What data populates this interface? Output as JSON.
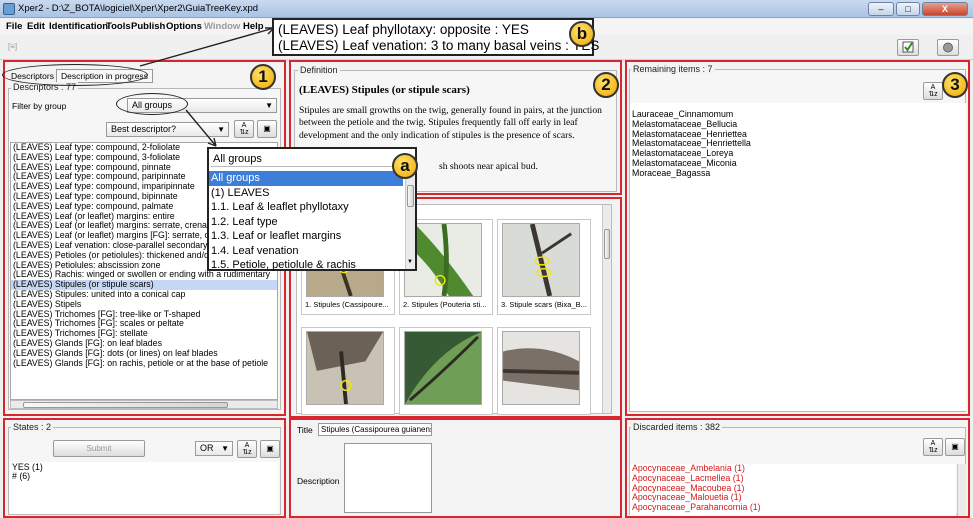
{
  "window": {
    "title": "Xper2 - D:\\Z_BOTA\\logiciel\\Xper\\Xper2\\GuiaTreeKey.xpd",
    "minimize": "–",
    "maximize": "□",
    "close": "X"
  },
  "menu": [
    "File",
    "Edit",
    "Identification",
    "Tools",
    "Publish",
    "Options",
    "Window",
    "Help"
  ],
  "callout_b": {
    "line1": "(LEAVES) Leaf phyllotaxy: opposite : YES",
    "line2": "(LEAVES) Leaf venation: 3 to many basal veins : YES",
    "badge": "b"
  },
  "panel1": {
    "badge": "1",
    "tab_descriptors": "Descriptors",
    "tab_progress": "Description in progress",
    "descriptors_legend": "Descriptors : 77",
    "filter_label": "Filter by group",
    "filter_value": "All groups",
    "best_descriptor": "Best descriptor?",
    "descriptors": [
      "(LEAVES) Leaf type: compound, 2-foliolate",
      "(LEAVES) Leaf type: compound, 3-foliolate",
      "(LEAVES) Leaf type: compound, pinnate",
      "(LEAVES) Leaf type: compound, paripinnate",
      "(LEAVES) Leaf type: compound, imparipinnate",
      "(LEAVES) Leaf type: compound, bipinnate",
      "(LEAVES) Leaf type: compound, palmate",
      "(LEAVES) Leaf (or leaflet) margins: entire",
      "(LEAVES) Leaf (or leaflet) margins: serrate, crenate",
      "(LEAVES) Leaf (or leaflet) margins [FG]: serrate, cre",
      "(LEAVES) Leaf venation: close-parallel secondary",
      "(LEAVES) Petioles (or petiolules): thickened and/or flexed at apex",
      "(LEAVES) Petiolules: abscission zone",
      "(LEAVES) Rachis: winged or swollen or ending with a rudimentary",
      "(LEAVES) Stipules (or stipule scars)",
      "(LEAVES) Stipules: united into a conical cap",
      "(LEAVES) Stipels",
      "(LEAVES) Trichomes [FG]: tree-like or T-shaped",
      "(LEAVES) Trichomes [FG]: scales or peltate",
      "(LEAVES) Trichomes [FG]: stellate",
      "(LEAVES) Glands [FG]: on leaf blades",
      "(LEAVES) Glands [FG]: dots (or lines) on leaf blades",
      "(LEAVES) Glands [FG]: on rachis, petiole or at the base of petiole"
    ],
    "selected_index": 14,
    "states_legend": "States : 2",
    "submit": "Submit",
    "operator": "OR",
    "states": [
      "YES (1)",
      "# (6)"
    ]
  },
  "dropdown_a": {
    "badge": "a",
    "header": "All groups",
    "items": [
      "All groups",
      "(1) LEAVES",
      "1.1. Leaf & leaflet phyllotaxy",
      "1.2. Leaf type",
      "1.3. Leaf or leaflet margins",
      "1.4. Leaf venation",
      "1.5. Petiole, petiolule & rachis"
    ]
  },
  "panel2": {
    "badge": "2",
    "definition_legend": "Definition",
    "definition_title": "(LEAVES) Stipules (or stipule scars)",
    "definition_text": "Stipules are small growths on the twig, generally found in pairs, at the junction between the petiole and the twig. Stipules frequently fall off early in leaf development and the only indication of stipules is the presence of scars.",
    "definition_text2": "sh shoots near apical bud.",
    "images": [
      "1. Stipules (Cassipoure...",
      "2. Stipules (Pouteria sti...",
      "3. Stipule scars (Bixa_B..."
    ],
    "title_label": "Title",
    "title_value": "Stipules (Cassipourea guianensis_Rhi",
    "description_label": "Description"
  },
  "panel3": {
    "badge": "3",
    "remaining_legend": "Remaining items : 7",
    "remaining": [
      "Lauraceae_Cinnamomum",
      "Melastomataceae_Bellucia",
      "Melastomataceae_Henriettea",
      "Melastomataceae_Henriettella",
      "Melastomataceae_Loreya",
      "Melastomataceae_Miconia",
      "Moraceae_Bagassa"
    ],
    "discarded_legend": "Discarded items : 382",
    "discarded": [
      "Apocynaceae_Ambelania (1)",
      "Apocynaceae_Lacmellea (1)",
      "Apocynaceae_Macoubea (1)",
      "Apocynaceae_Malouetia (1)",
      "Apocynaceae_Parahancornia (1)"
    ]
  },
  "colors": {
    "accent_red": "#d8262f",
    "badge_yellow": "#f0a800",
    "selection": "#3d7fd8",
    "discarded_text": "#d21a1a"
  }
}
